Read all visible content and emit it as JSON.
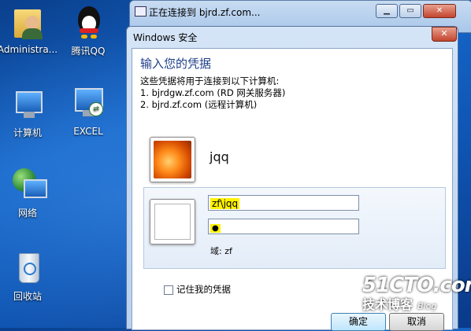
{
  "desktop": {
    "icons": [
      {
        "label": "Administra..."
      },
      {
        "label": "腾讯QQ"
      },
      {
        "label": "计算机"
      },
      {
        "label": "EXCEL"
      },
      {
        "label": "网络"
      },
      {
        "label": "回收站"
      }
    ]
  },
  "background_window": {
    "title": "正在连接到 bjrd.zf.com..."
  },
  "dialog": {
    "title": "Windows 安全",
    "heading": "输入您的凭据",
    "description": "这些凭据将用于连接到以下计算机:",
    "targets": [
      "1. bjrdgw.zf.com (RD 网关服务器)",
      "2. bjrd.zf.com (远程计算机)"
    ],
    "saved_user": "jqq",
    "username_value": "zf\\jqq",
    "password_mask": "●",
    "domain_label": "域: zf",
    "remember_label": "记住我的凭据",
    "ok_label": "确定",
    "cancel_label": "取消"
  },
  "watermark": {
    "line1": "51CTO.com",
    "line2": "技术博客",
    "line3": "Blog"
  },
  "colors": {
    "desktop": "#1565c8",
    "heading": "#1e3f8a",
    "highlight": "#fff200"
  }
}
